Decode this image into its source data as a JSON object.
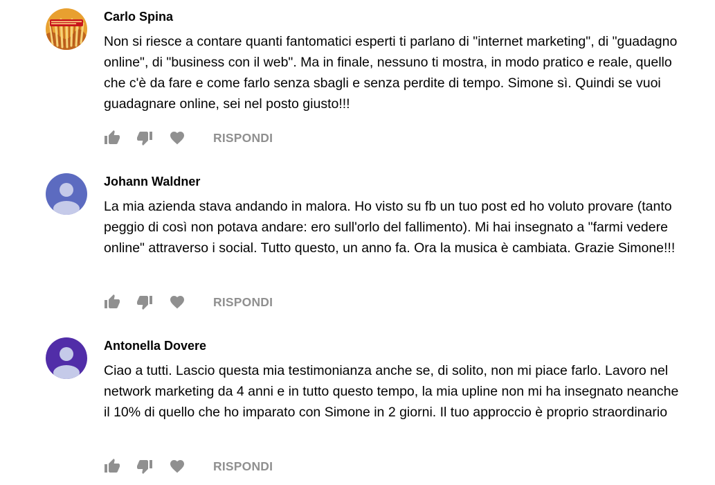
{
  "comments": [
    {
      "author": "Carlo Spina",
      "avatar": {
        "type": "photo",
        "colors": [
          "#e8a030",
          "#c0651d",
          "#f6d27a"
        ],
        "badge_color": "#c8161d"
      },
      "text": "Non si riesce a contare quanti fantomatici esperti ti parlano di \"internet marketing\", di \"guadagno online\", di \"business con il web\". Ma in finale, nessuno ti mostra, in modo pratico e reale, quello che c'è da fare e come farlo senza sbagli e senza perdite di tempo. Simone sì. Quindi se vuoi guadagnare online, sei nel posto giusto!!!",
      "reply_label": "RISPONDI"
    },
    {
      "author": "Johann Waldner",
      "avatar": {
        "type": "default",
        "color": "#5c6bc0"
      },
      "text": "La mia azienda stava andando in malora. Ho visto su fb un tuo post ed ho voluto provare (tanto peggio di così non potava andare: ero sull'orlo del fallimento). Mi hai insegnato a \"farmi vedere online\" attraverso i social. Tutto questo, un anno fa. Ora la musica è cambiata. Grazie Simone!!!",
      "reply_label": "RISPONDI"
    },
    {
      "author": "Antonella Dovere",
      "avatar": {
        "type": "default",
        "color": "#512da8"
      },
      "text": "Ciao a tutti. Lascio questa mia testimonianza anche se, di solito, non mi piace farlo. Lavoro nel network marketing da 4 anni e in tutto questo tempo, la mia upline non mi ha insegnato neanche il 10% di quello che ho imparato con Simone in 2 giorni. Il tuo approccio è proprio straordinario",
      "reply_label": "RISPONDI"
    }
  ],
  "icons": {
    "like": "thumb-up-icon",
    "dislike": "thumb-down-icon",
    "heart": "heart-icon"
  },
  "colors": {
    "icon": "#909090",
    "text": "#030303",
    "action_text": "#909090",
    "avatar_figure": "#c5cae9"
  }
}
